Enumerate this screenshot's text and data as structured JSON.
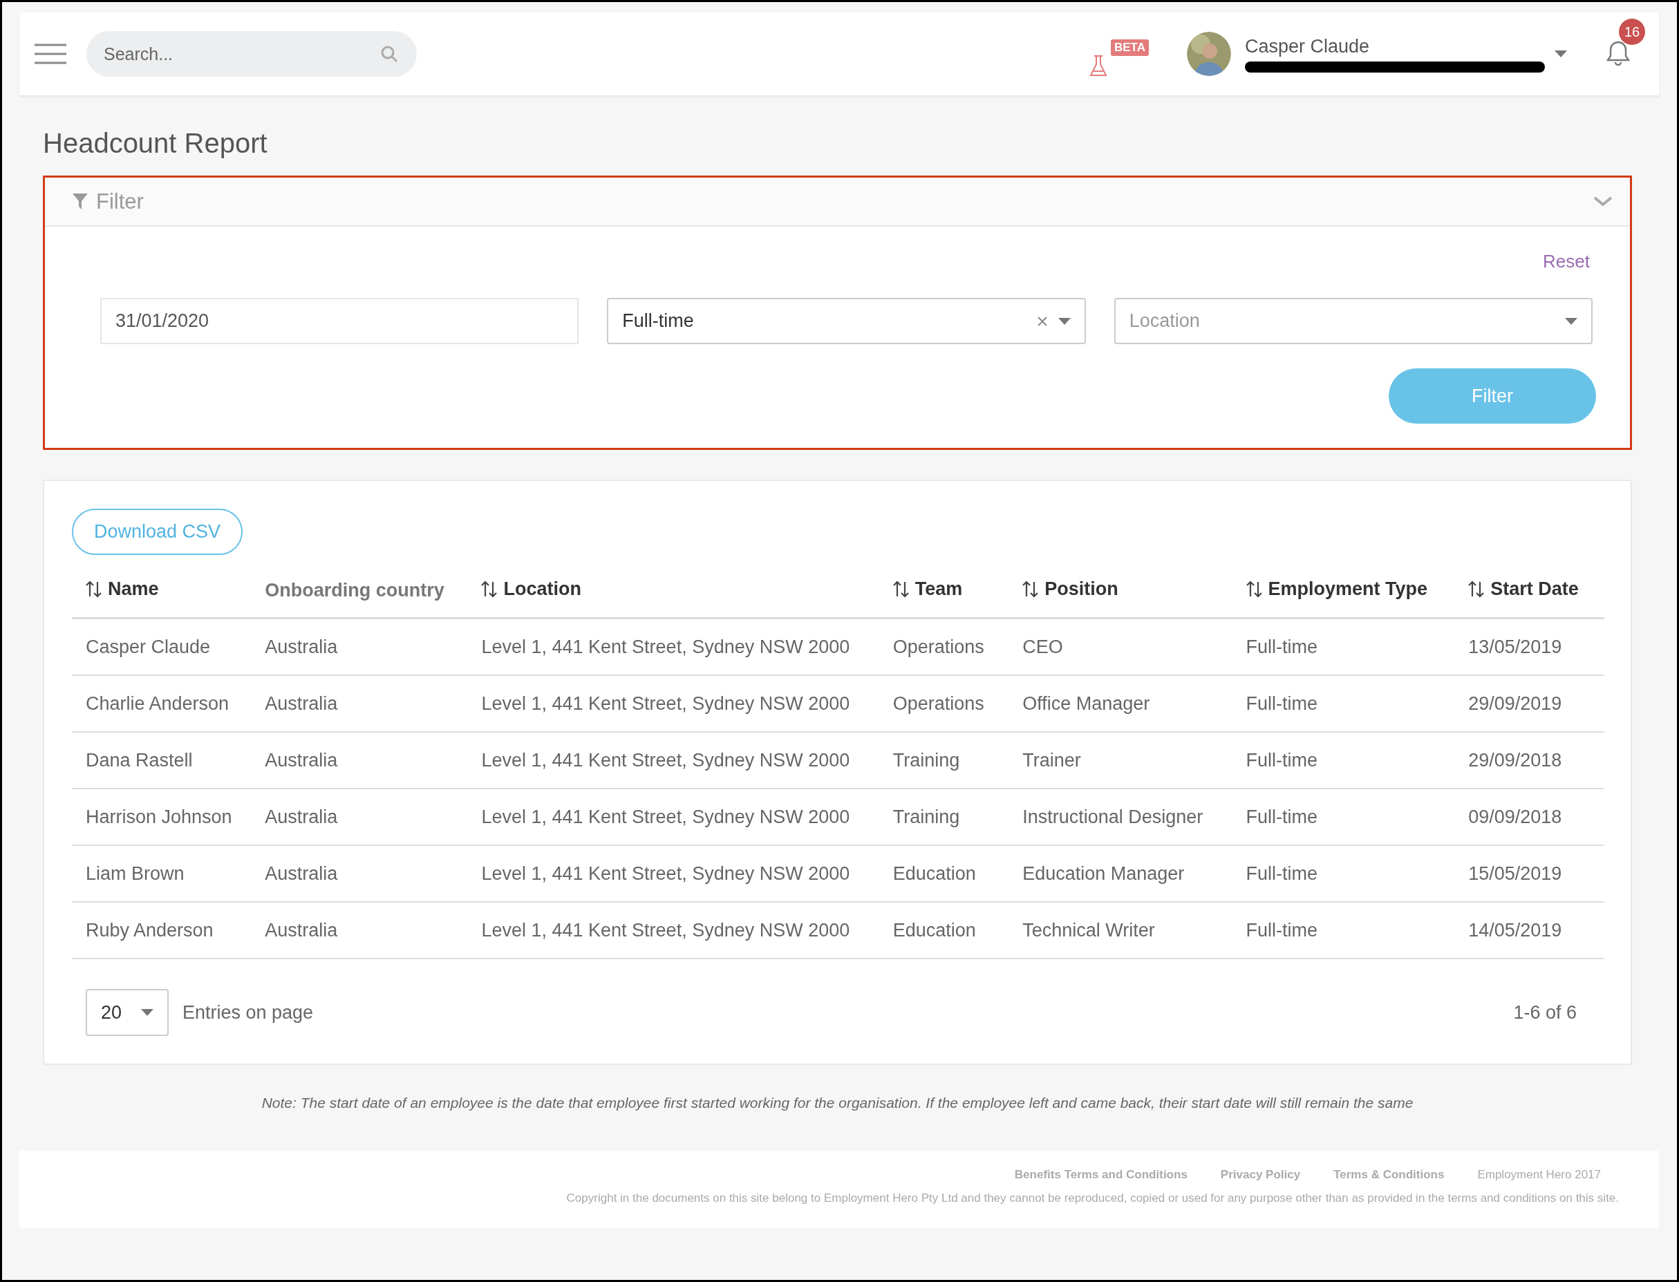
{
  "header": {
    "search": {
      "placeholder": "Search..."
    },
    "beta_badge": "BETA",
    "user": {
      "name": "Casper Claude"
    },
    "notifications": {
      "count": "16"
    }
  },
  "page_title": "Headcount Report",
  "filter": {
    "title": "Filter",
    "expanded": true,
    "reset": "Reset",
    "date": {
      "value": "31/01/2020"
    },
    "employment_type": {
      "value": "Full-time"
    },
    "location": {
      "placeholder": "Location"
    },
    "submit": "Filter"
  },
  "table": {
    "download": "Download CSV",
    "columns": [
      {
        "label": "Name",
        "sortable": true
      },
      {
        "label": "Onboarding country",
        "sortable": false
      },
      {
        "label": "Location",
        "sortable": true
      },
      {
        "label": "Team",
        "sortable": true
      },
      {
        "label": "Position",
        "sortable": true
      },
      {
        "label": "Employment Type",
        "sortable": true
      },
      {
        "label": "Start Date",
        "sortable": true
      }
    ],
    "rows": [
      [
        "Casper Claude",
        "Australia",
        "Level 1, 441 Kent Street, Sydney NSW 2000",
        "Operations",
        "CEO",
        "Full-time",
        "13/05/2019"
      ],
      [
        "Charlie Anderson",
        "Australia",
        "Level 1, 441 Kent Street, Sydney NSW 2000",
        "Operations",
        "Office Manager",
        "Full-time",
        "29/09/2019"
      ],
      [
        "Dana Rastell",
        "Australia",
        "Level 1, 441 Kent Street, Sydney NSW 2000",
        "Training",
        "Trainer",
        "Full-time",
        "29/09/2018"
      ],
      [
        "Harrison Johnson",
        "Australia",
        "Level 1, 441 Kent Street, Sydney NSW 2000",
        "Training",
        "Instructional Designer",
        "Full-time",
        "09/09/2018"
      ],
      [
        "Liam Brown",
        "Australia",
        "Level 1, 441 Kent Street, Sydney NSW 2000",
        "Education",
        "Education Manager",
        "Full-time",
        "15/05/2019"
      ],
      [
        "Ruby Anderson",
        "Australia",
        "Level 1, 441 Kent Street, Sydney NSW 2000",
        "Education",
        "Technical Writer",
        "Full-time",
        "14/05/2019"
      ]
    ]
  },
  "pagination": {
    "page_size": "20",
    "label": "Entries on page",
    "range": "1-6 of 6"
  },
  "note": "Note: The start date of an employee is the date that employee first started working for the organisation. If the employee left and came back, their start date will still remain the same",
  "footer": {
    "links": [
      "Benefits Terms and Conditions",
      "Privacy Policy",
      "Terms & Conditions"
    ],
    "brand": "Employment Hero 2017",
    "copyright": "Copyright in the documents on this site belong to Employment Hero Pty Ltd and they cannot be reproduced, copied or used for any purpose other than as provided in the terms and conditions on this site."
  }
}
